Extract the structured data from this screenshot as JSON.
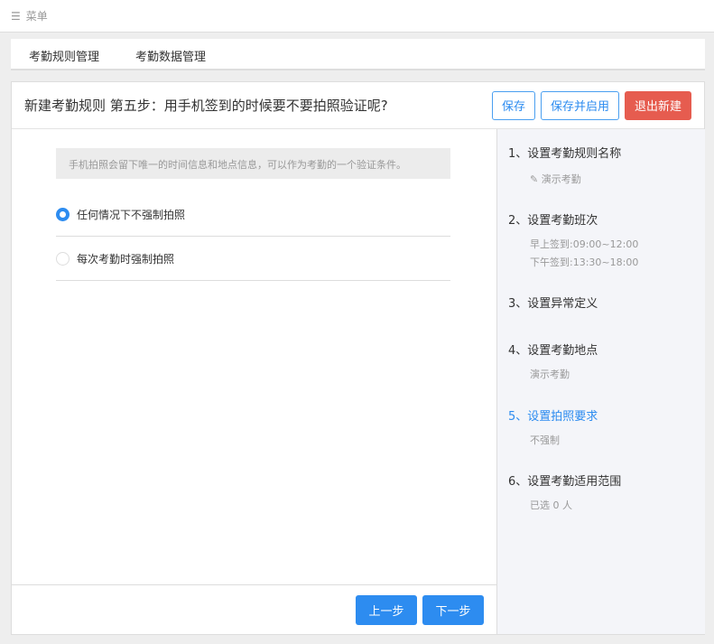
{
  "topbar": {
    "menu_icon": "☰",
    "menu_label": "菜单"
  },
  "tabs": [
    "考勤规则管理",
    "考勤数据管理"
  ],
  "header": {
    "title": "新建考勤规则 第五步：用手机签到的时候要不要拍照验证呢?",
    "save": "保存",
    "save_enable": "保存并启用",
    "exit": "退出新建"
  },
  "hint": "手机拍照会留下唯一的时间信息和地点信息，可以作为考勤的一个验证条件。",
  "options": [
    {
      "label": "任何情况下不强制拍照",
      "selected": true
    },
    {
      "label": "每次考勤时强制拍照",
      "selected": false
    }
  ],
  "footer": {
    "prev": "上一步",
    "next": "下一步"
  },
  "steps": [
    {
      "title": "1、设置考勤规则名称",
      "sub": [
        "演示考勤"
      ]
    },
    {
      "title": "2、设置考勤班次",
      "sub": [
        "早上签到:09:00~12:00",
        "下午签到:13:30~18:00"
      ]
    },
    {
      "title": "3、设置异常定义",
      "sub": []
    },
    {
      "title": "4、设置考勤地点",
      "sub": [
        "演示考勤"
      ]
    },
    {
      "title": "5、设置拍照要求",
      "sub": [
        "不强制"
      ]
    },
    {
      "title": "6、设置考勤适用范围",
      "sub": [
        "已选 0 人"
      ]
    }
  ],
  "colors": {
    "primary": "#2d8cf0",
    "danger": "#e65c4f"
  }
}
